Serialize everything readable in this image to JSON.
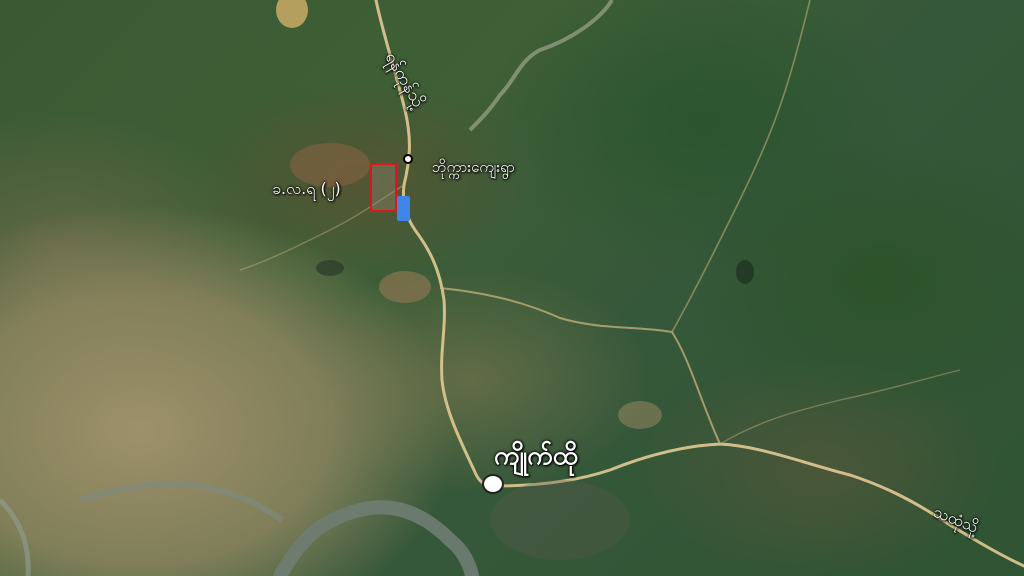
{
  "map": {
    "labels": {
      "north_road": "ရန်ကုန်သို့",
      "village": "ဘိုက္ကားကျေးရွာ",
      "site": "ခ.လ.ရ (၂)",
      "town": "ကျိုက်ထို",
      "east_road": "သထုံသို့"
    },
    "colors": {
      "road": "#d9c48e",
      "river": "#6f7d73",
      "site_box": "#e0151b",
      "marker": "#3f86e8"
    },
    "icons": {
      "site_marker": "blue-pin-icon",
      "village_marker": "village-dot-icon",
      "town_marker": "town-dot-icon"
    }
  }
}
